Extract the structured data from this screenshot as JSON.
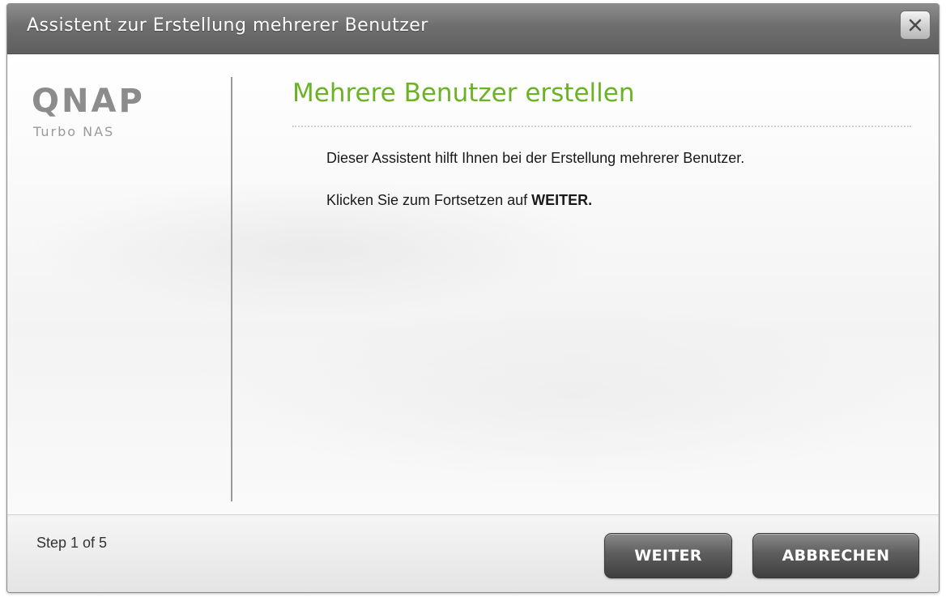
{
  "window": {
    "title": "Assistent zur Erstellung mehrerer Benutzer",
    "close_icon": "close-icon"
  },
  "sidebar": {
    "logo_text": "QNAP",
    "logo_sub": "Turbo NAS"
  },
  "main": {
    "heading": "Mehrere Benutzer erstellen",
    "line1": "Dieser Assistent hilft Ihnen bei der Erstellung mehrerer Benutzer.",
    "line2_prefix": "Klicken Sie zum Fortsetzen auf ",
    "line2_bold": "WEITER."
  },
  "footer": {
    "step": "Step 1 of 5",
    "next_label": "WEITER",
    "cancel_label": "ABBRECHEN"
  },
  "colors": {
    "heading_green": "#6bb324",
    "titlebar": "#6e6e6e",
    "button_dark": "#4a4a4a"
  }
}
